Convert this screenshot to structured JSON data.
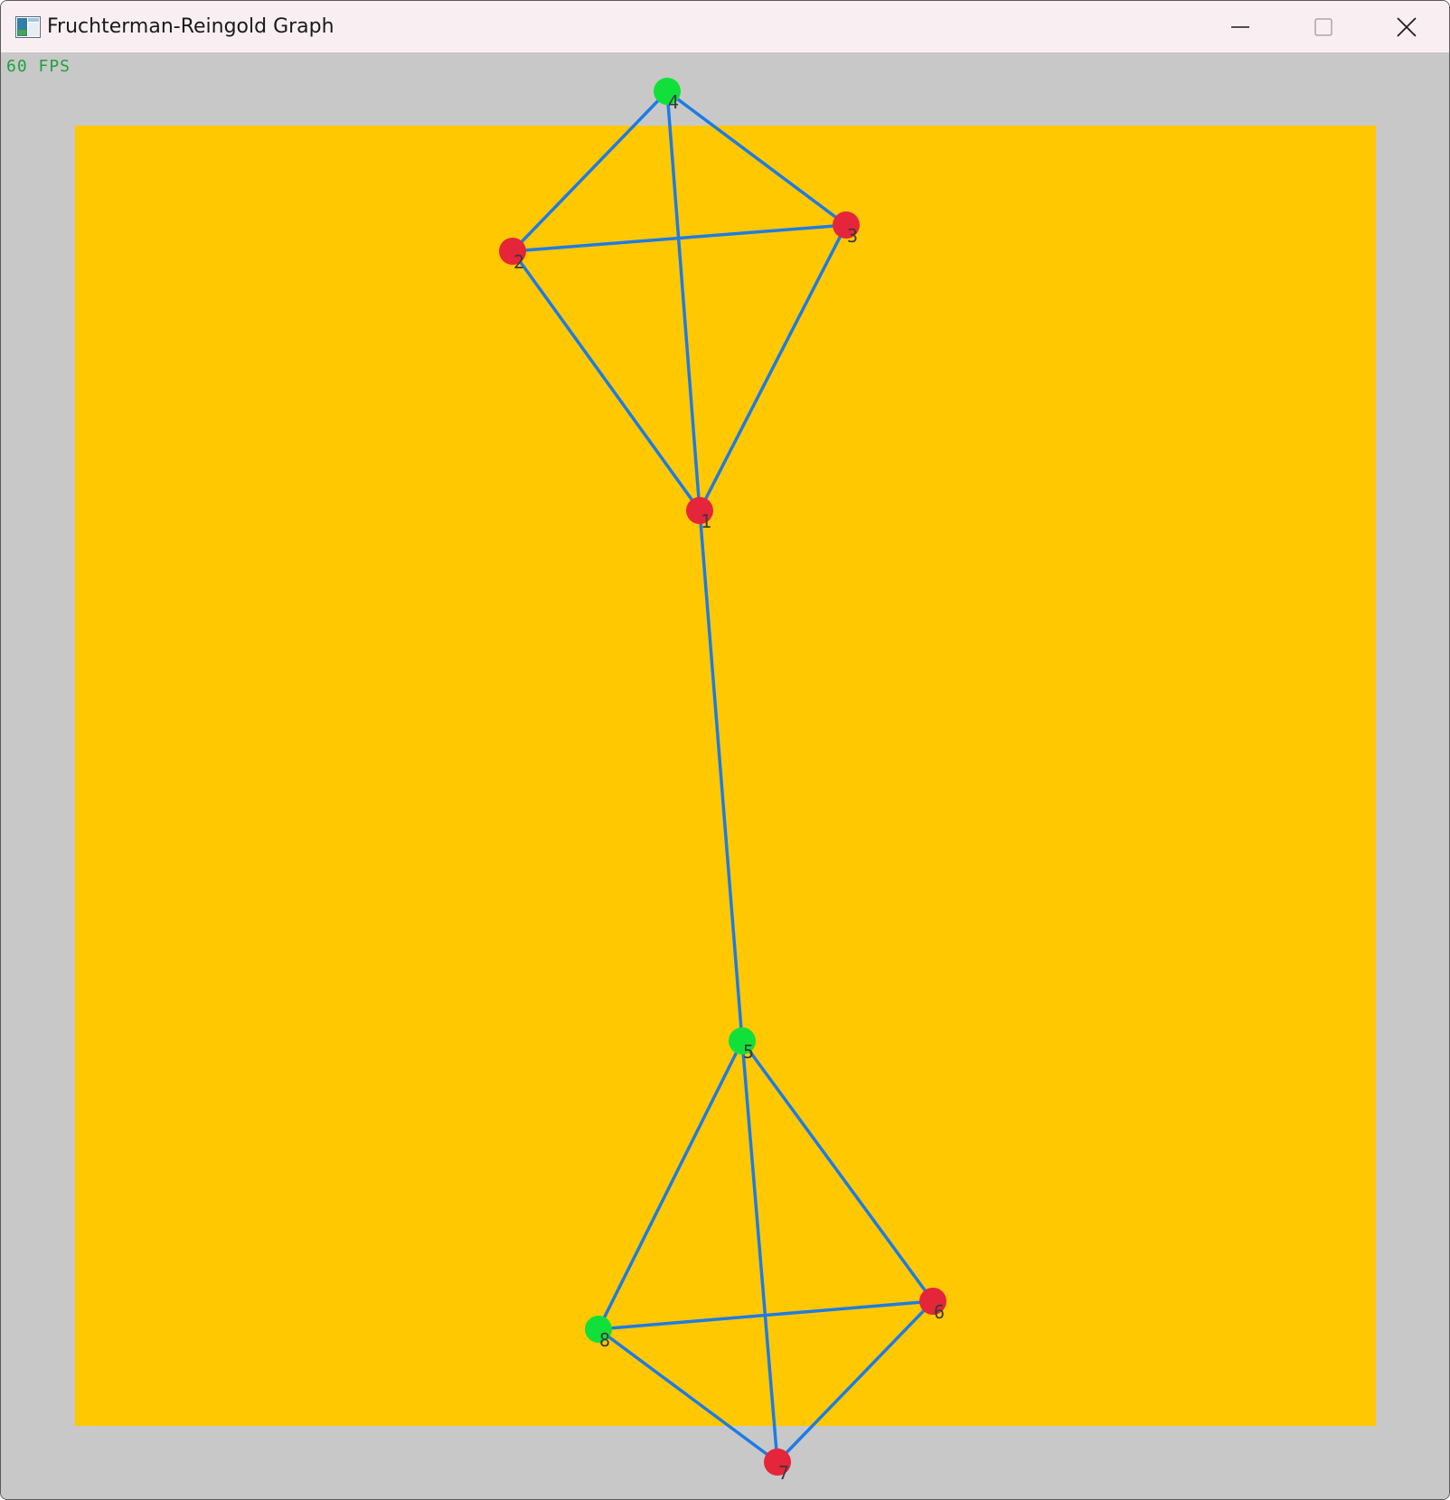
{
  "window": {
    "title": "Fruchterman-Reingold Graph",
    "minimize_icon": "minimize-icon",
    "maximize_icon": "maximize-icon",
    "close_icon": "close-icon"
  },
  "overlay": {
    "fps_text": "60 FPS",
    "fps_color": "#1fa13c"
  },
  "colors": {
    "canvas_background": "#c8c8c8",
    "graph_area": "#ffc800",
    "edge": "#1e7be4",
    "node_red": "#e5253a",
    "node_green": "#12e03a",
    "label": "#3a3a3a"
  },
  "graph": {
    "nodes": [
      {
        "id": 1,
        "label": "1",
        "color": "red"
      },
      {
        "id": 2,
        "label": "2",
        "color": "red"
      },
      {
        "id": 3,
        "label": "3",
        "color": "red"
      },
      {
        "id": 4,
        "label": "4",
        "color": "green"
      },
      {
        "id": 5,
        "label": "5",
        "color": "green"
      },
      {
        "id": 6,
        "label": "6",
        "color": "red"
      },
      {
        "id": 7,
        "label": "7",
        "color": "red"
      },
      {
        "id": 8,
        "label": "8",
        "color": "green"
      }
    ],
    "edges": [
      [
        4,
        2
      ],
      [
        4,
        3
      ],
      [
        4,
        1
      ],
      [
        2,
        3
      ],
      [
        2,
        1
      ],
      [
        3,
        1
      ],
      [
        1,
        5
      ],
      [
        5,
        8
      ],
      [
        5,
        6
      ],
      [
        5,
        7
      ],
      [
        8,
        6
      ],
      [
        8,
        7
      ],
      [
        6,
        7
      ]
    ]
  }
}
